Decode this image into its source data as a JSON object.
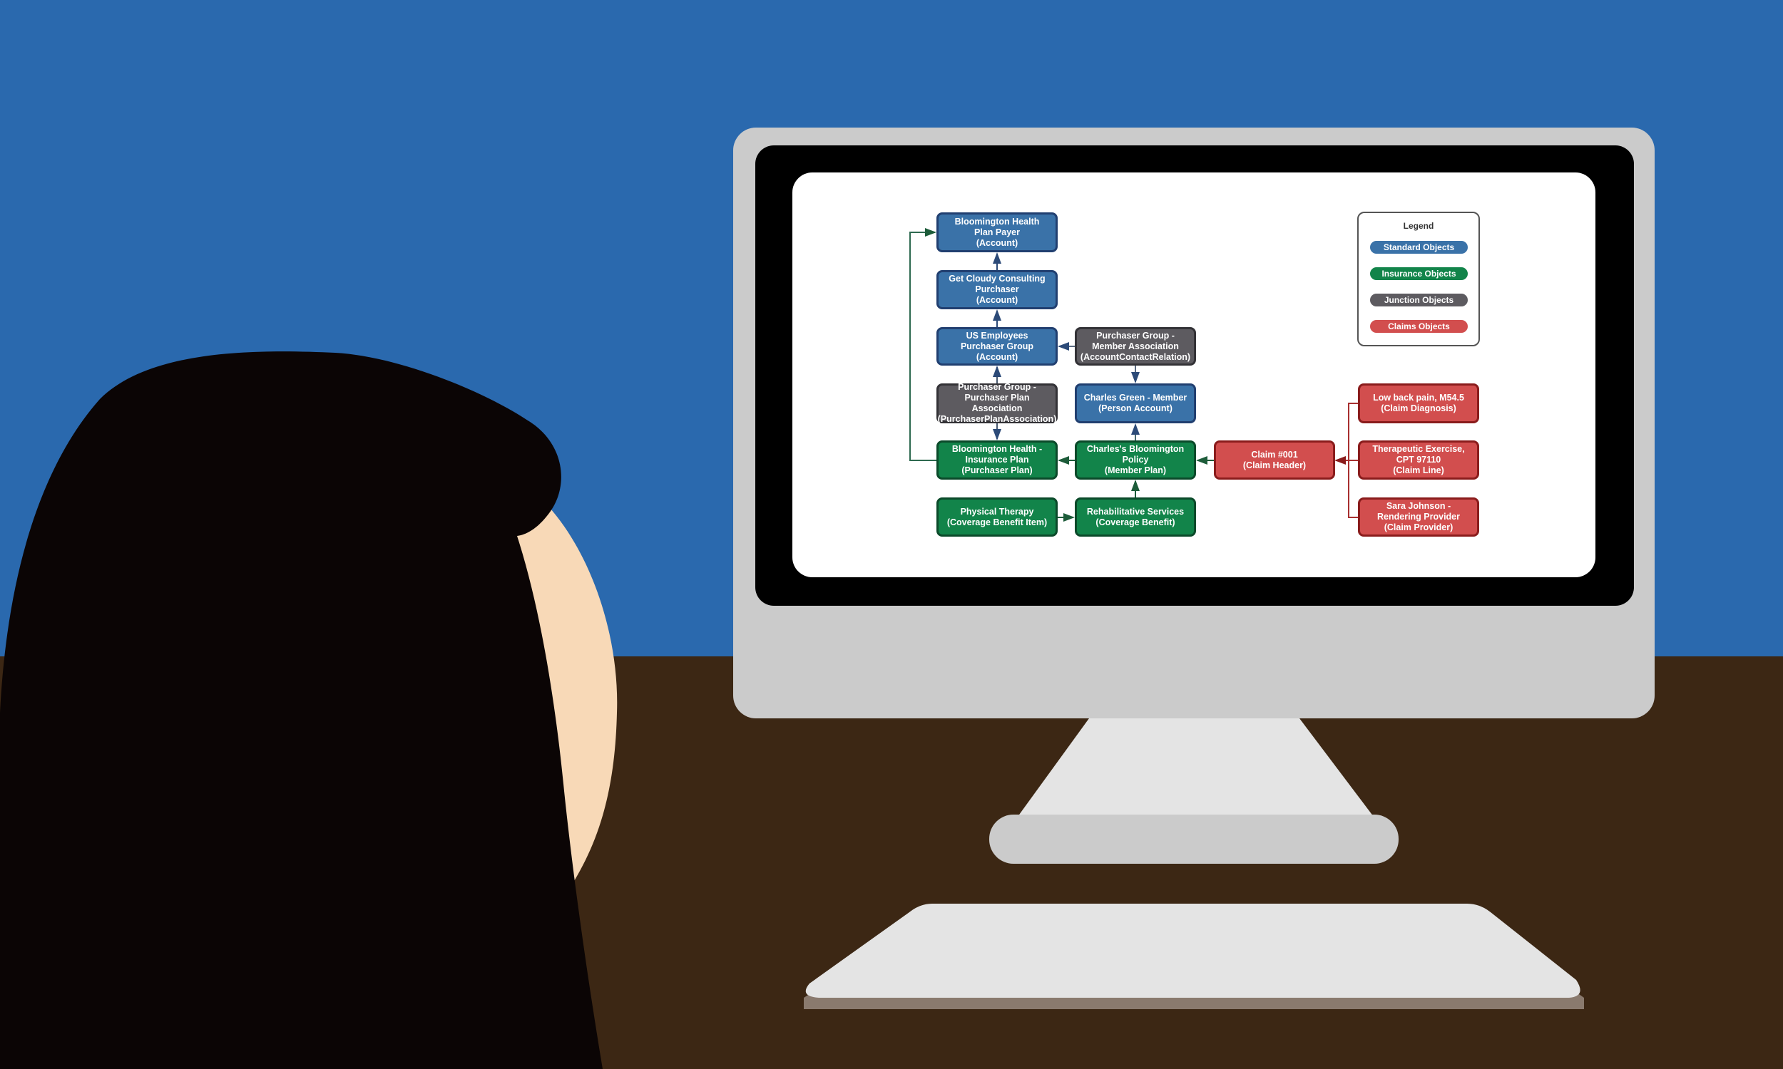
{
  "colors": {
    "background": "#2a69ae",
    "floor": "#3c2714",
    "standard": "#3a72a8",
    "insurance": "#12844a",
    "junction": "#5d5b60",
    "claims": "#d24e4e"
  },
  "diagram": {
    "nodes": [
      {
        "id": "payer",
        "type": "standard",
        "lines": [
          "Bloomington Health",
          "Plan Payer",
          "(Account)"
        ]
      },
      {
        "id": "purchaser",
        "type": "standard",
        "lines": [
          "Get Cloudy Consulting",
          "Purchaser",
          "(Account)"
        ]
      },
      {
        "id": "group",
        "type": "standard",
        "lines": [
          "US Employees",
          "Purchaser Group",
          "(Account)"
        ]
      },
      {
        "id": "pgma",
        "type": "junction",
        "lines": [
          "Purchaser Group -",
          "Member Association",
          "(AccountContactRelation)"
        ]
      },
      {
        "id": "ppa",
        "type": "junction",
        "lines": [
          "Purchaser Group -",
          "Purchaser Plan Association",
          "(PurchaserPlanAssociation)"
        ]
      },
      {
        "id": "member",
        "type": "standard",
        "lines": [
          "Charles Green - Member",
          "(Person Account)"
        ]
      },
      {
        "id": "plan",
        "type": "insurance",
        "lines": [
          "Bloomington Health -",
          "Insurance Plan",
          "(Purchaser Plan)"
        ]
      },
      {
        "id": "policy",
        "type": "insurance",
        "lines": [
          "Charles's  Bloomington",
          "Policy",
          "(Member Plan)"
        ]
      },
      {
        "id": "claim",
        "type": "claims",
        "lines": [
          "Claim #001",
          "(Claim Header)"
        ]
      },
      {
        "id": "diagnosis",
        "type": "claims",
        "lines": [
          "Low back pain, M54.5",
          "(Claim Diagnosis)"
        ]
      },
      {
        "id": "line",
        "type": "claims",
        "lines": [
          "Therapeutic Exercise,",
          "CPT 97110",
          "(Claim Line)"
        ]
      },
      {
        "id": "provider",
        "type": "claims",
        "lines": [
          "Sara Johnson -",
          "Rendering Provider",
          "(Claim Provider)"
        ]
      },
      {
        "id": "item",
        "type": "insurance",
        "lines": [
          "Physical Therapy",
          "(Coverage Benefit Item)"
        ]
      },
      {
        "id": "benefit",
        "type": "insurance",
        "lines": [
          "Rehabilitative Services",
          "(Coverage Benefit)"
        ]
      }
    ],
    "legend": {
      "title": "Legend",
      "items": [
        "Standard Objects",
        "Insurance Objects",
        "Junction Objects",
        "Claims Objects"
      ]
    }
  }
}
